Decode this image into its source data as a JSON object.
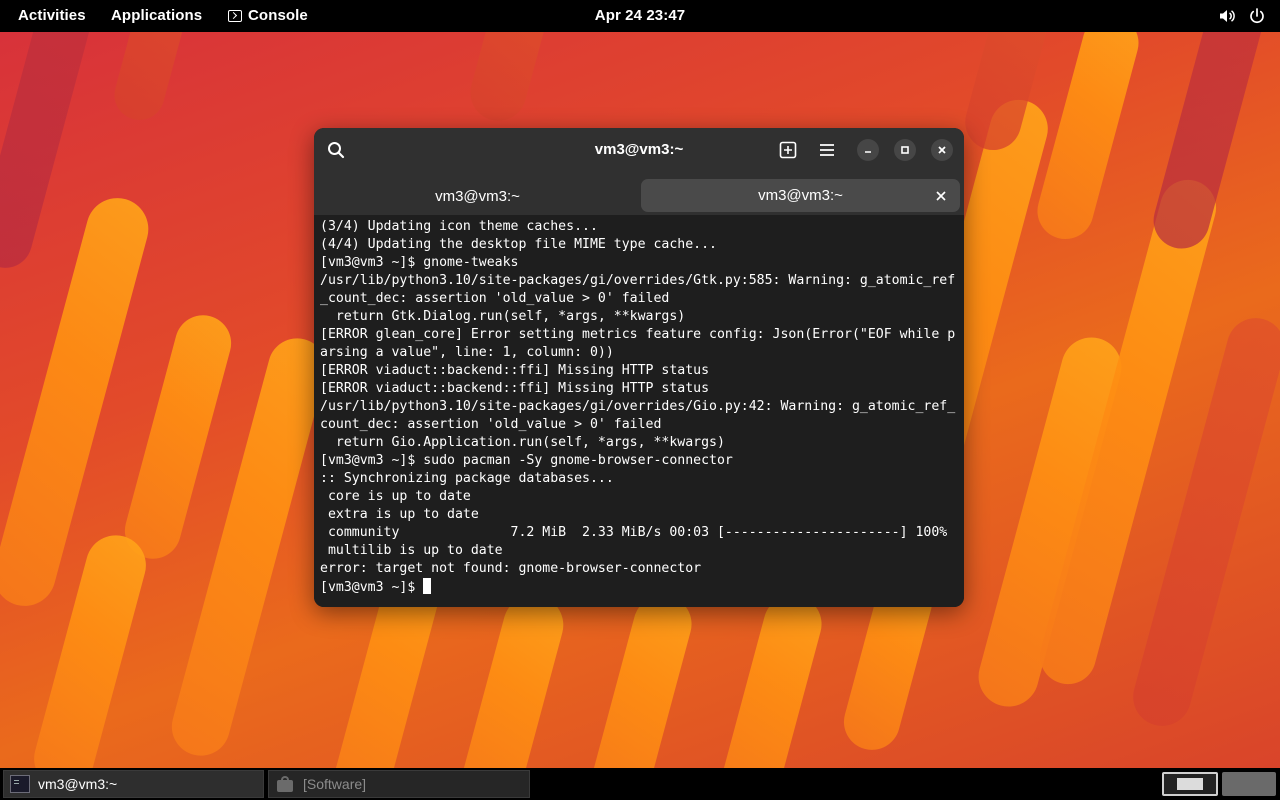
{
  "topbar": {
    "activities": "Activities",
    "applications": "Applications",
    "console": "Console",
    "clock": "Apr 24  23:47",
    "tray_icons": [
      "volume-icon",
      "power-icon"
    ]
  },
  "window": {
    "title": "vm3@vm3:~",
    "tabs": [
      {
        "label": "vm3@vm3:~",
        "active": false
      },
      {
        "label": "vm3@vm3:~",
        "active": true
      }
    ],
    "terminal_lines": [
      "(3/4) Updating icon theme caches...",
      "(4/4) Updating the desktop file MIME type cache...",
      "[vm3@vm3 ~]$ gnome-tweaks",
      "/usr/lib/python3.10/site-packages/gi/overrides/Gtk.py:585: Warning: g_atomic_ref",
      "_count_dec: assertion 'old_value > 0' failed",
      "  return Gtk.Dialog.run(self, *args, **kwargs)",
      "[ERROR glean_core] Error setting metrics feature config: Json(Error(\"EOF while p",
      "arsing a value\", line: 1, column: 0))",
      "[ERROR viaduct::backend::ffi] Missing HTTP status",
      "[ERROR viaduct::backend::ffi] Missing HTTP status",
      "/usr/lib/python3.10/site-packages/gi/overrides/Gio.py:42: Warning: g_atomic_ref_",
      "count_dec: assertion 'old_value > 0' failed",
      "  return Gio.Application.run(self, *args, **kwargs)",
      "[vm3@vm3 ~]$ sudo pacman -Sy gnome-browser-connector",
      ":: Synchronizing package databases...",
      " core is up to date",
      " extra is up to date",
      " community              7.2 MiB  2.33 MiB/s 00:03 [----------------------] 100%",
      " multilib is up to date",
      "error: target not found: gnome-browser-connector"
    ],
    "prompt": "[vm3@vm3 ~]$ "
  },
  "taskbar": {
    "tasks": [
      {
        "label": "vm3@vm3:~",
        "icon": "terminal-icon",
        "active": true
      },
      {
        "label": "[Software]",
        "icon": "software-icon",
        "active": false
      }
    ],
    "workspaces": [
      {
        "label": "",
        "active": true
      },
      {
        "label": "",
        "active": false
      }
    ]
  },
  "colors": {
    "topbar_bg": "#000000",
    "headerbar_bg": "#303030",
    "terminal_bg": "#1e1e1e",
    "terminal_fg": "#ffffff",
    "active_tab_bg": "#4a4a4a"
  }
}
